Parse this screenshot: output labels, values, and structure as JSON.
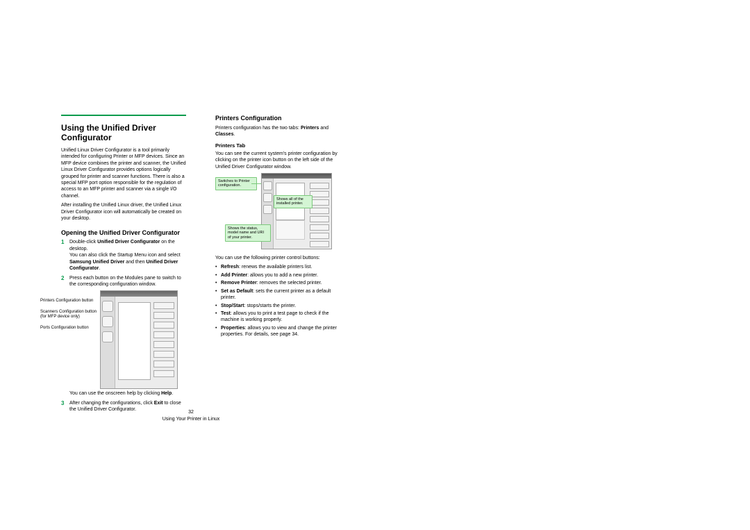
{
  "left": {
    "title": "Using the Unified Driver Configurator",
    "para1": "Unified Linux Driver Configurator is a tool primarily intended for configuring Printer or MFP devices. Since an MFP device combines the printer and scanner, the Unified Linux Driver Configurator provides options logically grouped for printer and scanner functions. There is also a special MFP port option responsible for the regulation of access to an MFP printer and scanner via a single I/O channel.",
    "para2": "After installing the Unified Linux driver, the Unified Linux Driver Configurator icon will automatically be created on your desktop.",
    "h2": "Opening the Unified Driver Configurator",
    "step1_a": "Double-click ",
    "step1_b": "Unified Driver Configurator",
    "step1_c": " on the desktop.",
    "step1_d": "You can also click the Startup Menu icon and select ",
    "step1_e": "Samsung Unified Driver",
    "step1_f": " and then ",
    "step1_g": "Unified Driver Configurator",
    "step1_h": ".",
    "step2": "Press each button on the Modules pane to switch to the corresponding configuration window.",
    "labels": {
      "printers": "Printers Configuration button",
      "scanners": "Scanners Configuration button (for MFP device only)",
      "ports": "Ports Configuration button"
    },
    "step2_help_a": "You can use the onscreen help by clicking ",
    "step2_help_b": "Help",
    "step2_help_c": ".",
    "step3_a": "After changing the configurations, click ",
    "step3_b": "Exit",
    "step3_c": " to close the Unified Driver Configurator."
  },
  "right": {
    "h2": "Printers Configuration",
    "tabs_a": "Printers configuration has the two tabs: ",
    "tabs_b": "Printers",
    "tabs_c": " and ",
    "tabs_d": "Classes",
    "tabs_e": ".",
    "h3": "Printers Tab",
    "para": "You can see the current system's printer configuration by clicking on the printer icon button on the left side of the Unified Driver Configurator window.",
    "callouts": {
      "c1": "Switches to Printer configuration.",
      "c2": "Shows all of the installed printer.",
      "c3": "Shows the status, model name and URI of your printer."
    },
    "controls_intro": "You can use the following printer control buttons:",
    "bullets": {
      "b1a": "Refresh",
      "b1b": ": renews the available printers list.",
      "b2a": "Add Printer",
      "b2b": ": allows you to add a new printer.",
      "b3a": "Remove Printer",
      "b3b": ": removes the selected printer.",
      "b4a": "Set as Default",
      "b4b": ": sets the current printer as a default printer.",
      "b5a": "Stop/Start",
      "b5b": ": stops/starts the printer.",
      "b6a": "Test",
      "b6b": ": allows you to print a test page to check if the machine is working properly.",
      "b7a": "Properties",
      "b7b": ": allows you to view and change the printer properties. For details, see page 34."
    }
  },
  "footer": {
    "page": "32",
    "section": "Using Your Printer in Linux"
  }
}
